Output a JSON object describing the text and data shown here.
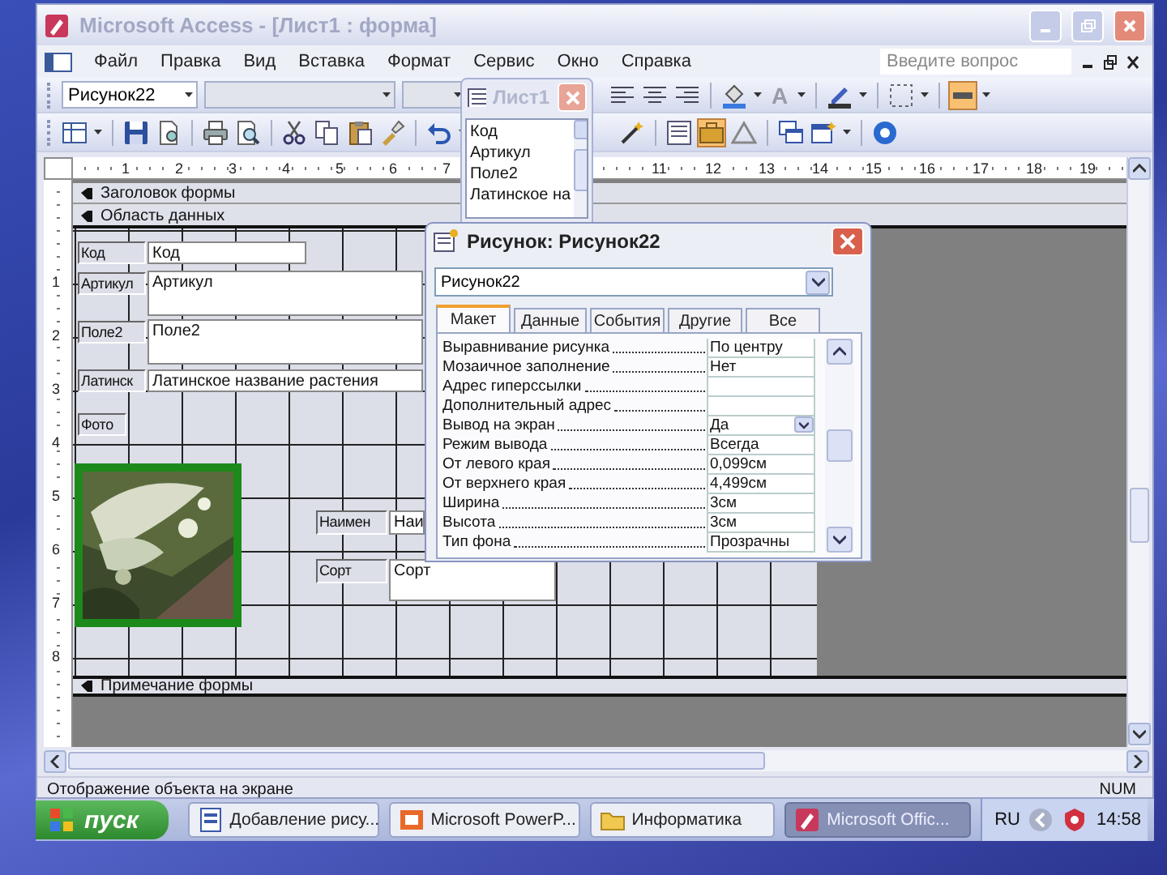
{
  "window": {
    "title": "Microsoft Access - [Лист1 : форма]"
  },
  "menu": [
    "Файл",
    "Правка",
    "Вид",
    "Вставка",
    "Формат",
    "Сервис",
    "Окно",
    "Справка"
  ],
  "help_box": {
    "placeholder": "Введите вопрос"
  },
  "formatting_toolbar": {
    "object": "Рисунок22",
    "font_color_glyph": "A"
  },
  "ruler": {
    "horizontal": [
      "1",
      "2",
      "3",
      "4",
      "5",
      "6",
      "7",
      "11",
      "12",
      "13",
      "14",
      "15",
      "16",
      "17",
      "18",
      "19"
    ],
    "vertical": [
      "1",
      "2",
      "3",
      "4",
      "5",
      "6",
      "7",
      "8"
    ]
  },
  "header_section": "Заголовок формы",
  "detail_section": "Область данных",
  "footer_section": "Примечание формы",
  "controls": [
    {
      "label": "Код",
      "field": "Код"
    },
    {
      "label": "Артикул",
      "field": "Артикул"
    },
    {
      "label": "Поле2",
      "field": "Поле2"
    },
    {
      "label": "Латинск",
      "field": "Латинское название растения"
    },
    {
      "label": "Фото"
    },
    {
      "label": "Наимен",
      "field": "Наи"
    },
    {
      "label": "Сорт",
      "field": "Сорт"
    }
  ],
  "field_list": {
    "title": "Лист1",
    "fields": [
      "Код",
      "Артикул",
      "Поле2",
      "Латинское на"
    ]
  },
  "properties": {
    "title": "Рисунок: Рисунок22",
    "object": "Рисунок22",
    "tabs": [
      {
        "label": "Макет",
        "selected": true
      },
      {
        "label": "Данные",
        "selected": false
      },
      {
        "label": "События",
        "selected": false
      },
      {
        "label": "Другие",
        "selected": false
      },
      {
        "label": "Все",
        "selected": false
      }
    ],
    "rows": [
      {
        "name": "Выравнивание рисунка",
        "value": "По центру",
        "kind": "text"
      },
      {
        "name": "Мозаичное заполнение",
        "value": "Нет",
        "kind": "text"
      },
      {
        "name": "Адрес гиперссылки",
        "kind": "text"
      },
      {
        "name": "Дополнительный адрес",
        "kind": "text"
      },
      {
        "name": "Вывод на экран",
        "value": "Да",
        "kind": "dropdown"
      },
      {
        "name": "Режим вывода",
        "value": "Всегда",
        "kind": "text"
      },
      {
        "name": "От левого края",
        "value": "0,099см",
        "kind": "text"
      },
      {
        "name": "От верхнего края",
        "value": "4,499см",
        "kind": "text"
      },
      {
        "name": "Ширина",
        "value": "3см",
        "kind": "text"
      },
      {
        "name": "Высота",
        "value": "3см",
        "kind": "text"
      },
      {
        "name": "Тип фона",
        "value": "Прозрачны",
        "kind": "text"
      }
    ]
  },
  "status_bar": {
    "message": "Отображение объекта на экране",
    "indicator": "NUM"
  },
  "taskbar": {
    "start": "пуск",
    "buttons": [
      {
        "label": "Добавление рису...",
        "selected": false
      },
      {
        "label": "Microsoft PowerP...",
        "selected": false
      },
      {
        "label": "Информатика",
        "selected": false
      },
      {
        "label": "Microsoft Offic...",
        "selected": true
      }
    ],
    "language": "RU",
    "clock": "14:58"
  }
}
